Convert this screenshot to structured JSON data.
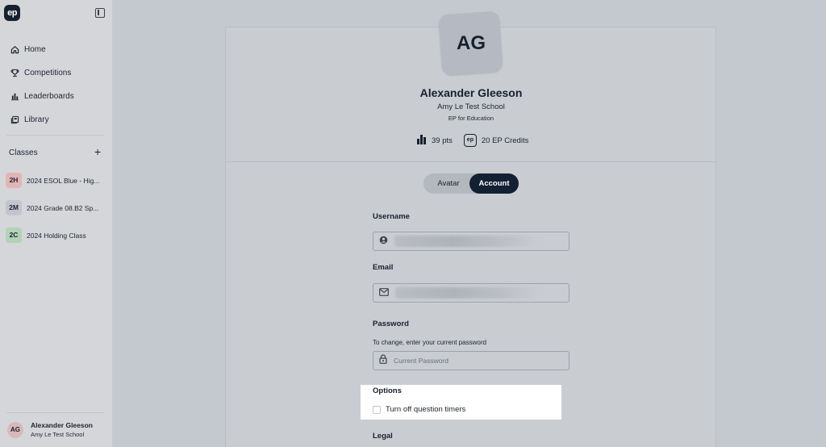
{
  "app": {
    "logo_text": "ep"
  },
  "sidebar": {
    "nav": [
      {
        "label": "Home",
        "icon": "home-icon"
      },
      {
        "label": "Competitions",
        "icon": "trophy-icon"
      },
      {
        "label": "Leaderboards",
        "icon": "bar-chart-icon"
      },
      {
        "label": "Library",
        "icon": "library-icon"
      }
    ],
    "classes_heading": "Classes",
    "add_symbol": "+",
    "classes": [
      {
        "badge": "2H",
        "name": "2024 ESOL Blue - Hig...",
        "color": "#e3b4b6"
      },
      {
        "badge": "2M",
        "name": "2024 Grade 08.B2 Sp...",
        "color": "#c2c5cc"
      },
      {
        "badge": "2C",
        "name": "2024 Holding Class",
        "color": "#b3d2b8"
      }
    ],
    "user": {
      "initials": "AG",
      "name": "Alexander Gleeson",
      "school": "Amy Le Test School"
    }
  },
  "profile": {
    "initials": "AG",
    "name": "Alexander Gleeson",
    "school": "Amy Le Test School",
    "org": "EP for Education",
    "points": "39 pts",
    "credits_badge": "ep",
    "credits": "20 EP Credits"
  },
  "tabs": {
    "avatar": "Avatar",
    "account": "Account",
    "selected": "Account"
  },
  "form": {
    "username_label": "Username",
    "email_label": "Email",
    "password_label": "Password",
    "password_hint": "To change, enter your current password",
    "password_placeholder": "Current Password",
    "options_label": "Options",
    "timer_option": "Turn off question timers",
    "timer_checked": false,
    "legal_label": "Legal"
  }
}
